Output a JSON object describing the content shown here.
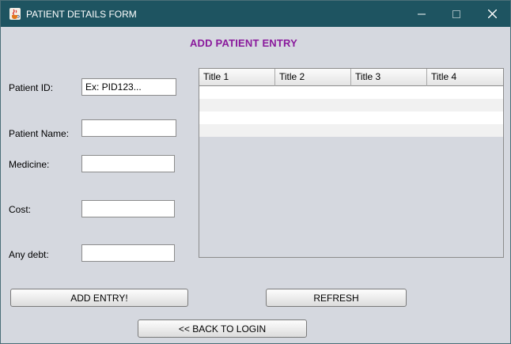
{
  "window": {
    "title": "PATIENT DETAILS FORM",
    "controls": {
      "minimize": "—",
      "maximize": "☐",
      "close": "✕"
    },
    "icon": "java-coffee-cup-icon"
  },
  "form": {
    "heading": "ADD PATIENT ENTRY",
    "heading_color": "#8a1a9c",
    "patient_id": {
      "label": "Patient ID:",
      "value": "Ex: PID123..."
    },
    "patient_name": {
      "label": "Patient Name:",
      "value": ""
    },
    "medicine": {
      "label": "Medicine:",
      "value": ""
    },
    "cost": {
      "label": "Cost:",
      "value": ""
    },
    "any_debt": {
      "label": "Any debt:",
      "value": ""
    }
  },
  "table": {
    "columns": [
      "Title 1",
      "Title 2",
      "Title 3",
      "Title 4"
    ],
    "rows": [
      [
        "",
        "",
        "",
        ""
      ],
      [
        "",
        "",
        "",
        ""
      ],
      [
        "",
        "",
        "",
        ""
      ],
      [
        "",
        "",
        "",
        ""
      ]
    ]
  },
  "buttons": {
    "add_entry": "ADD ENTRY!",
    "refresh": "REFRESH",
    "back_to_login": "<< BACK TO LOGIN"
  },
  "colors": {
    "titlebar": "#1e5461",
    "background": "#d5d8df"
  }
}
